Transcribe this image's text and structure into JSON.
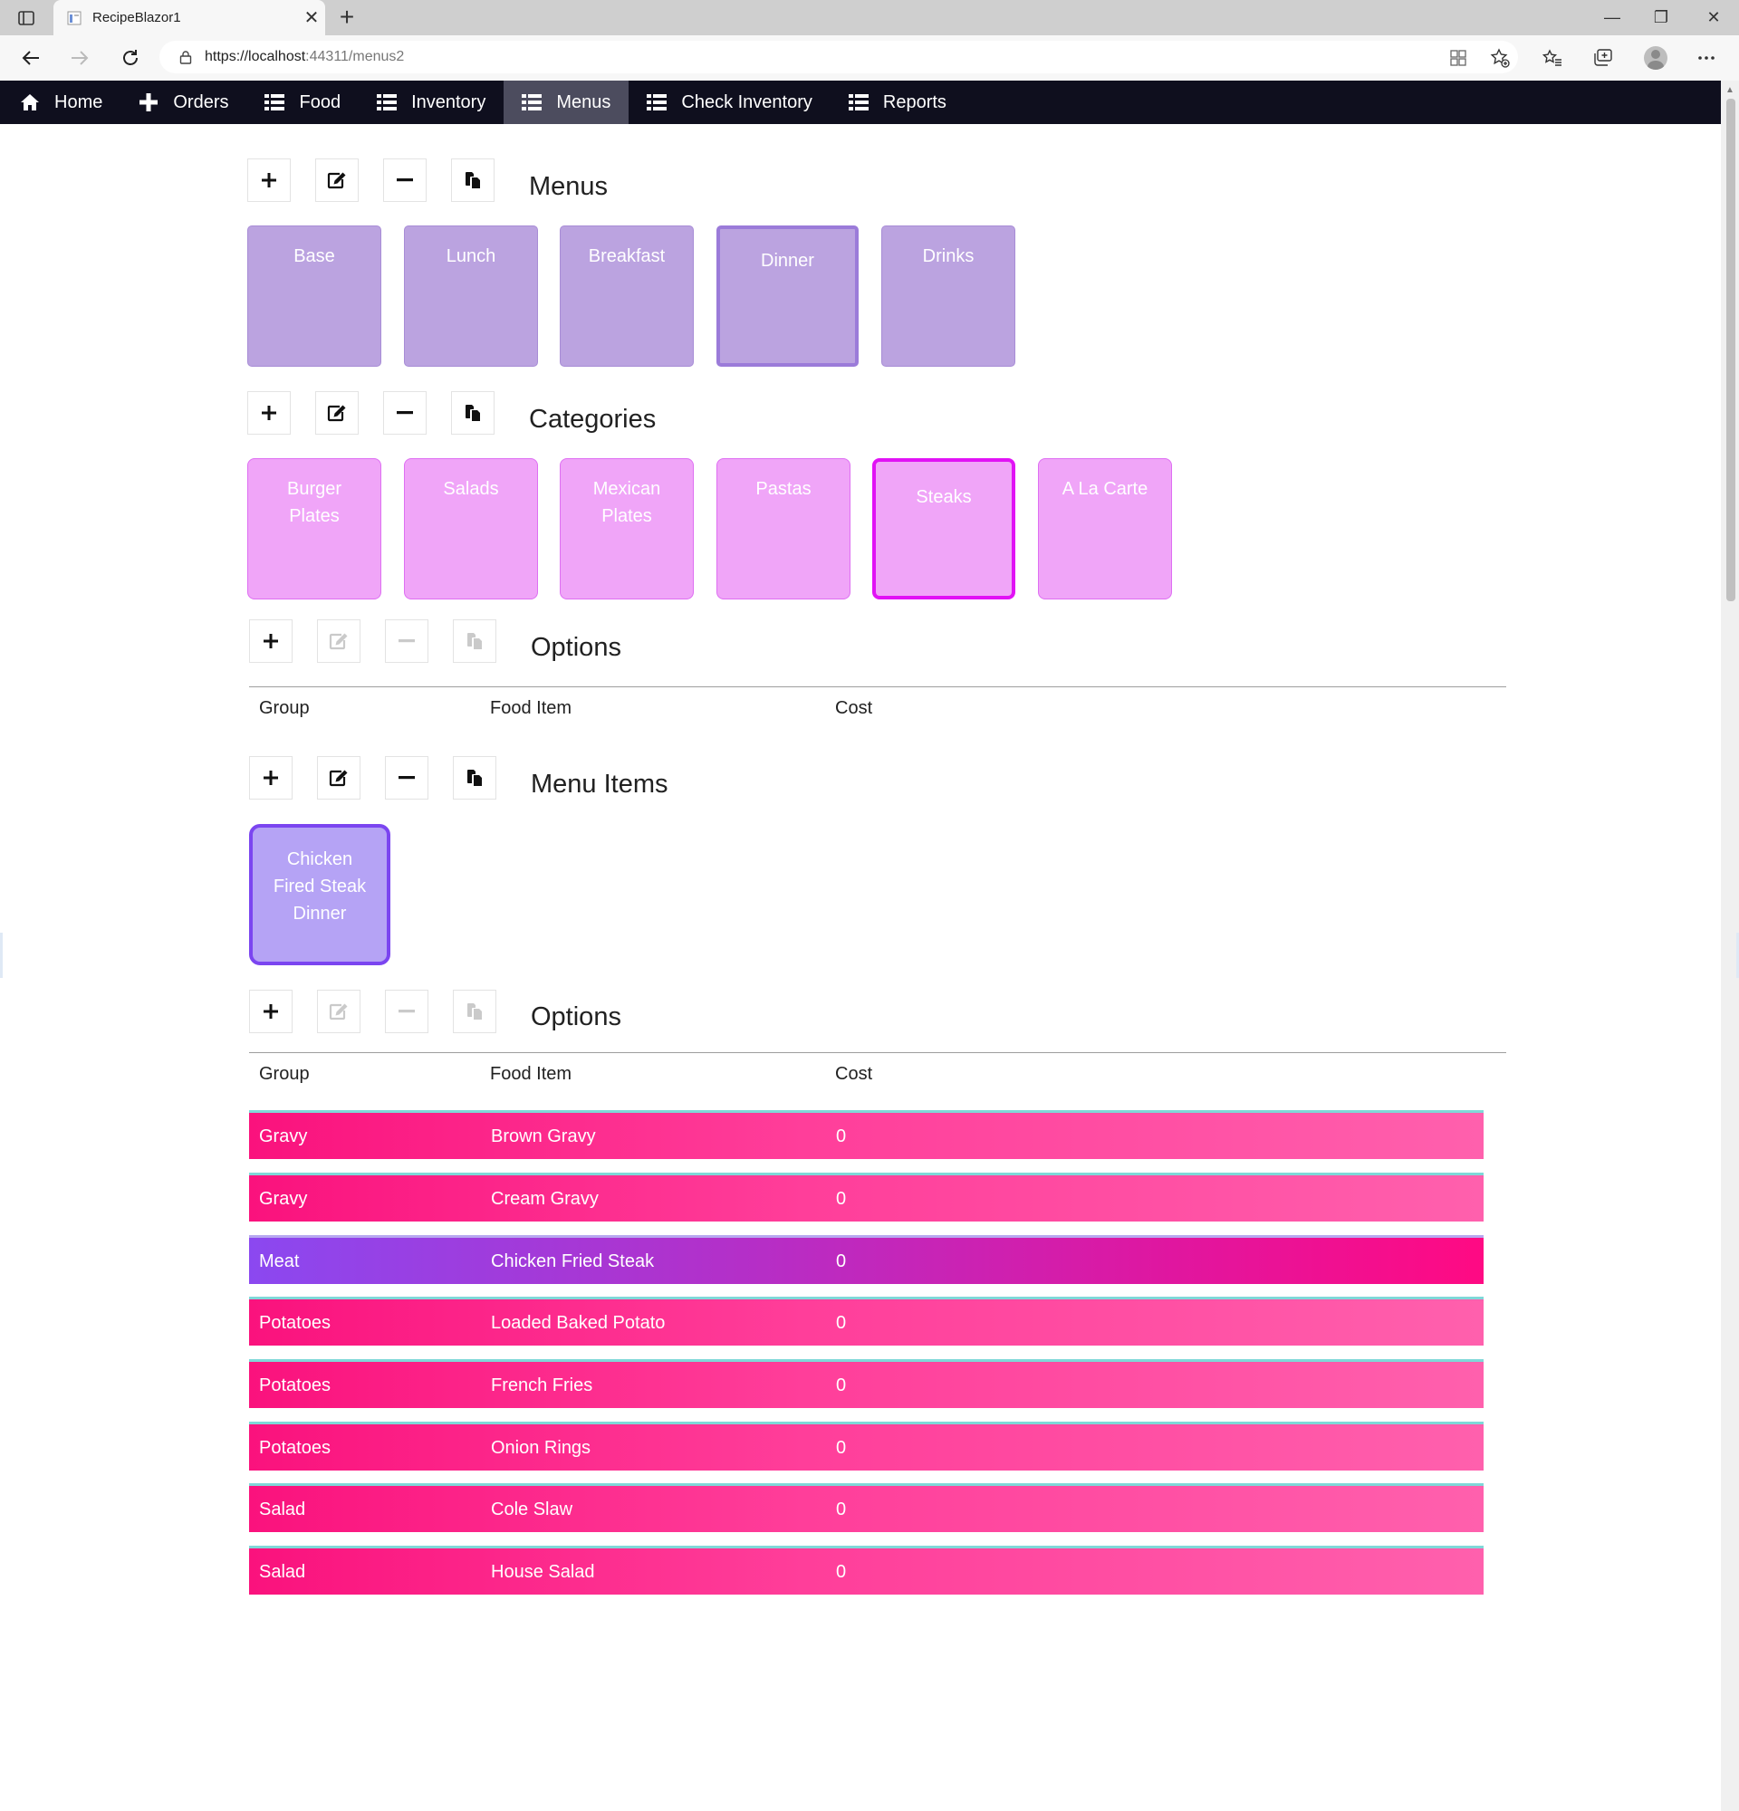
{
  "browser": {
    "tab_title": "RecipeBlazor1",
    "url_host": "https://localhost",
    "url_rest": ":44311/menus2"
  },
  "nav": {
    "items": [
      {
        "label": "Home",
        "icon": "home-icon"
      },
      {
        "label": "Orders",
        "icon": "plus-icon"
      },
      {
        "label": "Food",
        "icon": "list-icon"
      },
      {
        "label": "Inventory",
        "icon": "list-icon"
      },
      {
        "label": "Menus",
        "icon": "list-icon",
        "active": true
      },
      {
        "label": "Check Inventory",
        "icon": "list-icon"
      },
      {
        "label": "Reports",
        "icon": "list-icon"
      }
    ]
  },
  "menus": {
    "title": "Menus",
    "tiles": [
      "Base",
      "Lunch",
      "Breakfast",
      "Dinner",
      "Drinks"
    ],
    "selected": "Dinner"
  },
  "categories": {
    "title": "Categories",
    "tiles": [
      "Burger Plates",
      "Salads",
      "Mexican Plates",
      "Pastas",
      "Steaks",
      "A La Carte"
    ],
    "selected": "Steaks"
  },
  "options_top": {
    "title": "Options",
    "headers": {
      "group": "Group",
      "food_item": "Food Item",
      "cost": "Cost"
    }
  },
  "menu_items": {
    "title": "Menu Items",
    "tiles": [
      "Chicken Fired Steak Dinner"
    ]
  },
  "options_bottom": {
    "title": "Options",
    "headers": {
      "group": "Group",
      "food_item": "Food Item",
      "cost": "Cost"
    },
    "rows": [
      {
        "group": "Gravy",
        "food_item": "Brown Gravy",
        "cost": "0"
      },
      {
        "group": "Gravy",
        "food_item": "Cream Gravy",
        "cost": "0"
      },
      {
        "group": "Meat",
        "food_item": "Chicken Fried Steak",
        "cost": "0",
        "highlight": true
      },
      {
        "group": "Potatoes",
        "food_item": "Loaded Baked Potato",
        "cost": "0"
      },
      {
        "group": "Potatoes",
        "food_item": "French Fries",
        "cost": "0"
      },
      {
        "group": "Potatoes",
        "food_item": "Onion Rings",
        "cost": "0"
      },
      {
        "group": "Salad",
        "food_item": "Cole Slaw",
        "cost": "0"
      },
      {
        "group": "Salad",
        "food_item": "House Salad",
        "cost": "0"
      }
    ]
  },
  "colors": {
    "nav_bg": "#0f0f1e",
    "menu_tile": "#bba3e0",
    "category_tile": "#f0a5f8",
    "category_selected_border": "#e112f5",
    "menu_item_tile": "#b5a3f5",
    "option_row": "#fa127d",
    "option_row_highlight": "#8b48f0"
  }
}
